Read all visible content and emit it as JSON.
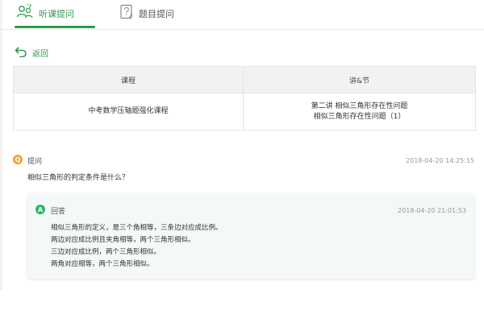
{
  "tabs": [
    {
      "label": "听课提问",
      "active": true,
      "icon": "group-question-icon"
    },
    {
      "label": "题目提问",
      "active": false,
      "icon": "question-sheet-icon"
    }
  ],
  "back": {
    "label": "返回",
    "icon": "back-arrow-icon"
  },
  "table": {
    "headers": [
      "课程",
      "讲&节"
    ],
    "row": {
      "course": "中考数学压轴题强化课程",
      "section_line1": "第二讲 相似三角形存在性问题",
      "section_line2": "相似三角形存在性问题（1）"
    }
  },
  "question": {
    "badge": "Q",
    "title": "提问",
    "time": "2018-04-20 14:25:15",
    "text": "相似三角形的判定条件是什么？"
  },
  "answer": {
    "badge": "A",
    "title": "回答",
    "time": "2018-04-20 21:01:53",
    "lines": [
      "相似三角形的定义，是三个角相等，三条边对应成比例。",
      "两边对应成比例且夹角相等，两个三角形相似。",
      "三边对应成比例，两个三角形相似。",
      "两角对应相等，两个三角形相似。"
    ]
  },
  "colors": {
    "accent": "#2d9a4f",
    "question_badge": "#f0a431",
    "answer_badge": "#2fb36a"
  }
}
